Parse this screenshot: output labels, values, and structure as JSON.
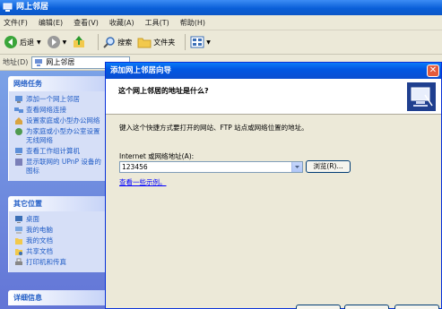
{
  "window": {
    "title": "网上邻居",
    "menu": [
      "文件(F)",
      "编辑(E)",
      "查看(V)",
      "收藏(A)",
      "工具(T)",
      "帮助(H)"
    ],
    "toolbar": {
      "back": "后退",
      "search": "搜索",
      "folders": "文件夹"
    },
    "address": {
      "label": "地址(D)",
      "value": "网上邻居"
    }
  },
  "taskpane": {
    "network_tasks": {
      "title": "网络任务",
      "items": [
        "添加一个网上邻居",
        "查看网络连接",
        "设置家庭或小型办公网络",
        "为家庭或小型办公室设置无线网络",
        "查看工作组计算机",
        "显示联网的 UPnP 设备的图标"
      ]
    },
    "other_places": {
      "title": "其它位置",
      "items": [
        "桌面",
        "我的电脑",
        "我的文档",
        "共享文档",
        "打印机和传真"
      ]
    },
    "details": {
      "title": "详细信息"
    }
  },
  "dialog": {
    "title": "添加网上邻居向导",
    "question": "这个网上邻居的地址是什么?",
    "description": "键入这个快捷方式要打开的网站、FTP 站点或网络位置的地址。",
    "address_label": "Internet 或网络地址(A):",
    "address_value": "123456",
    "browse_label": "浏览(R)...",
    "examples_link": "查看一些示例。"
  }
}
